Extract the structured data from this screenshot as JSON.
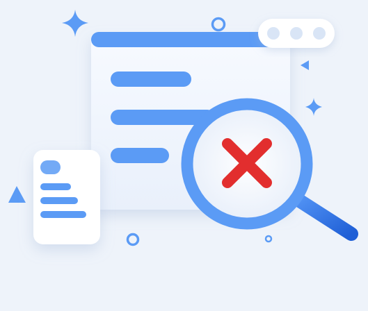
{
  "illustration": {
    "kind": "search no results",
    "status_icon": "close-icon",
    "colors": {
      "background": "#eef3fa",
      "accent_blue": "#5b9bf5",
      "handle_blue": "#2f6fe0",
      "error_red": "#e22e2e",
      "card_white": "#ffffff",
      "panel_light": "#f4f8fd"
    }
  }
}
